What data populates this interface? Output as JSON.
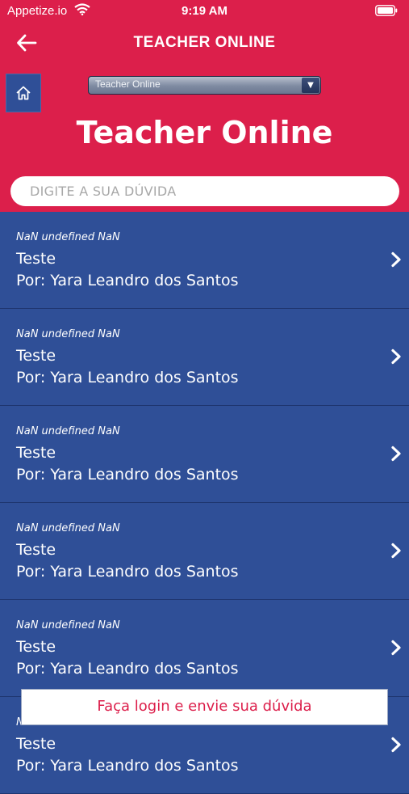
{
  "status_bar": {
    "carrier": "Appetize.io",
    "time": "9:19 AM"
  },
  "navbar": {
    "title": "TEACHER ONLINE"
  },
  "selector": {
    "value": "Teacher Online"
  },
  "page": {
    "title": "Teacher Online"
  },
  "search": {
    "placeholder": "DIGITE A SUA DÚVIDA"
  },
  "questions": [
    {
      "date": "NaN undefined NaN",
      "title": "Teste",
      "author": "Por: Yara Leandro dos Santos"
    },
    {
      "date": "NaN undefined NaN",
      "title": "Teste",
      "author": "Por: Yara Leandro dos Santos"
    },
    {
      "date": "NaN undefined NaN",
      "title": "Teste",
      "author": "Por: Yara Leandro dos Santos"
    },
    {
      "date": "NaN undefined NaN",
      "title": "Teste",
      "author": "Por: Yara Leandro dos Santos"
    },
    {
      "date": "NaN undefined NaN",
      "title": "Teste",
      "author": "Por: Yara Leandro dos Santos"
    },
    {
      "date": "NaN undefined NaN",
      "title": "Teste",
      "author": "Por: Yara Leandro dos Santos"
    }
  ],
  "login_bar": {
    "label": "Faça login e envie sua dúvida"
  },
  "colors": {
    "header": "#dc1f4b",
    "list_background": "#2f4f97",
    "accent_text": "#dc1f4b"
  },
  "icons": {
    "back": "arrow-left-icon",
    "home": "home-icon",
    "dropdown": "triangle-down-icon",
    "row": "chevron-right-icon"
  }
}
